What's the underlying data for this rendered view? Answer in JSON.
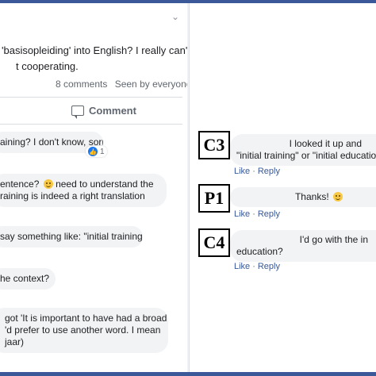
{
  "post": {
    "chevron": "⌄",
    "lines": [
      "'basisopleiding' into English? I really can't",
      "t cooperating."
    ],
    "comments_count": "8 comments",
    "seen": "Seen by everyone"
  },
  "comment_action": "Comment",
  "left_comments": [
    {
      "text": "aining? I don't know, sorry",
      "reaction_count": "1"
    },
    {
      "line1": "entence?",
      "line1b": " need to understand the",
      "line2": "raining is indeed a right translation"
    },
    {
      "text": "say something like: \"initial training\""
    },
    {
      "text": "he context?"
    },
    {
      "line1": "got 'It is important to have had a broad",
      "line2": "'d prefer to use another word. I mean",
      "line3": "jaar)"
    }
  ],
  "right_comments": [
    {
      "label": "C3",
      "line1": "I looked it up and",
      "line2": "\"initial training\" or \"initial education\""
    },
    {
      "label": "P1",
      "line1": "Thanks!"
    },
    {
      "label": "C4",
      "line1": "I'd go with the in",
      "line2": "education?"
    }
  ],
  "actions": {
    "like": "Like",
    "reply": "Reply"
  }
}
